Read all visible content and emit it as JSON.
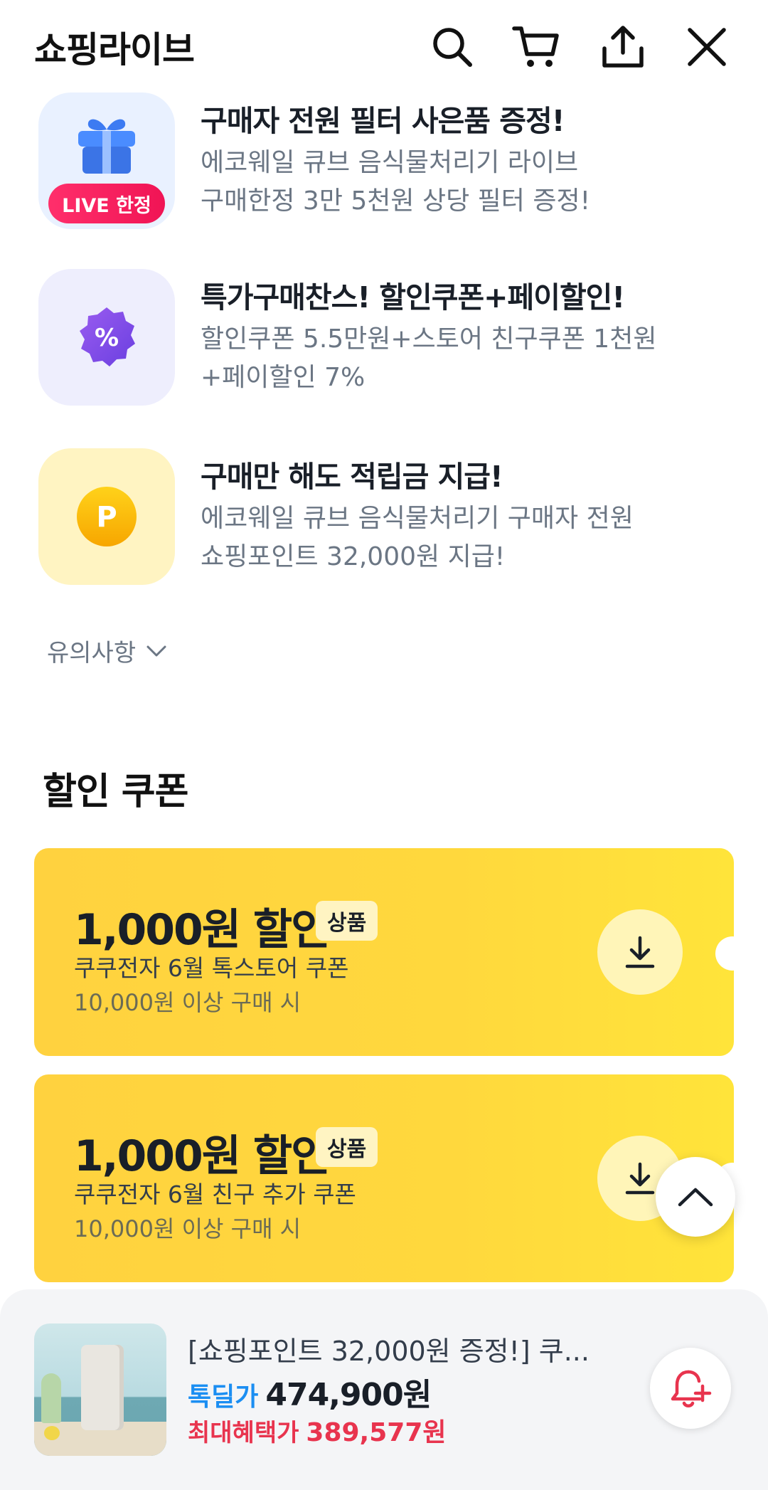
{
  "header": {
    "title": "쇼핑라이브",
    "icons": [
      "search-icon",
      "cart-icon",
      "share-icon",
      "close-icon"
    ]
  },
  "benefits": [
    {
      "title": "구매자 전원 필터 사은품 증정!",
      "desc_line1": "에코웨일 큐브 음식물처리기 라이브",
      "desc_line2": "구매한정 3만 5천원 상당 필터 증정!",
      "badge": "LIVE 한정",
      "icon": "gift-icon"
    },
    {
      "title": "특가구매찬스! 할인쿠폰+페이할인!",
      "desc_line1": "할인쿠폰 5.5만원+스토어 친구쿠폰 1천원",
      "desc_line2": "+페이할인 7%",
      "icon": "percent-badge-icon",
      "icon_glyph": "%"
    },
    {
      "title": "구매만 해도 적립금 지급!",
      "desc_line1": "에코웨일 큐브 음식물처리기 구매자 전원",
      "desc_line2": "쇼핑포인트 32,000원 지급!",
      "icon": "point-coin-icon",
      "icon_glyph": "P"
    }
  ],
  "notice": {
    "label": "유의사항"
  },
  "coupon_section": {
    "title": "할인 쿠폰"
  },
  "coupons": [
    {
      "amount": "1,000원 할인",
      "tag": "상품",
      "name": "쿠쿠전자 6월 톡스토어 쿠폰",
      "condition": "10,000원 이상 구매 시"
    },
    {
      "amount": "1,000원 할인",
      "tag": "상품",
      "name": "쿠쿠전자 6월 친구 추가 쿠폰",
      "condition": "10,000원 이상 구매 시"
    }
  ],
  "bottom_bar": {
    "product_title": "[쇼핑포인트 32,000원 증정!] 쿠...",
    "price_label": "톡딜가",
    "price": "474,900원",
    "max_label": "최대혜택가",
    "max_price": "389,577원"
  },
  "colors": {
    "coupon_yellow": "#ffd83d",
    "price_blue": "#1b8ef2",
    "benefit_red": "#e8344e",
    "live_pink": "#f01455"
  }
}
